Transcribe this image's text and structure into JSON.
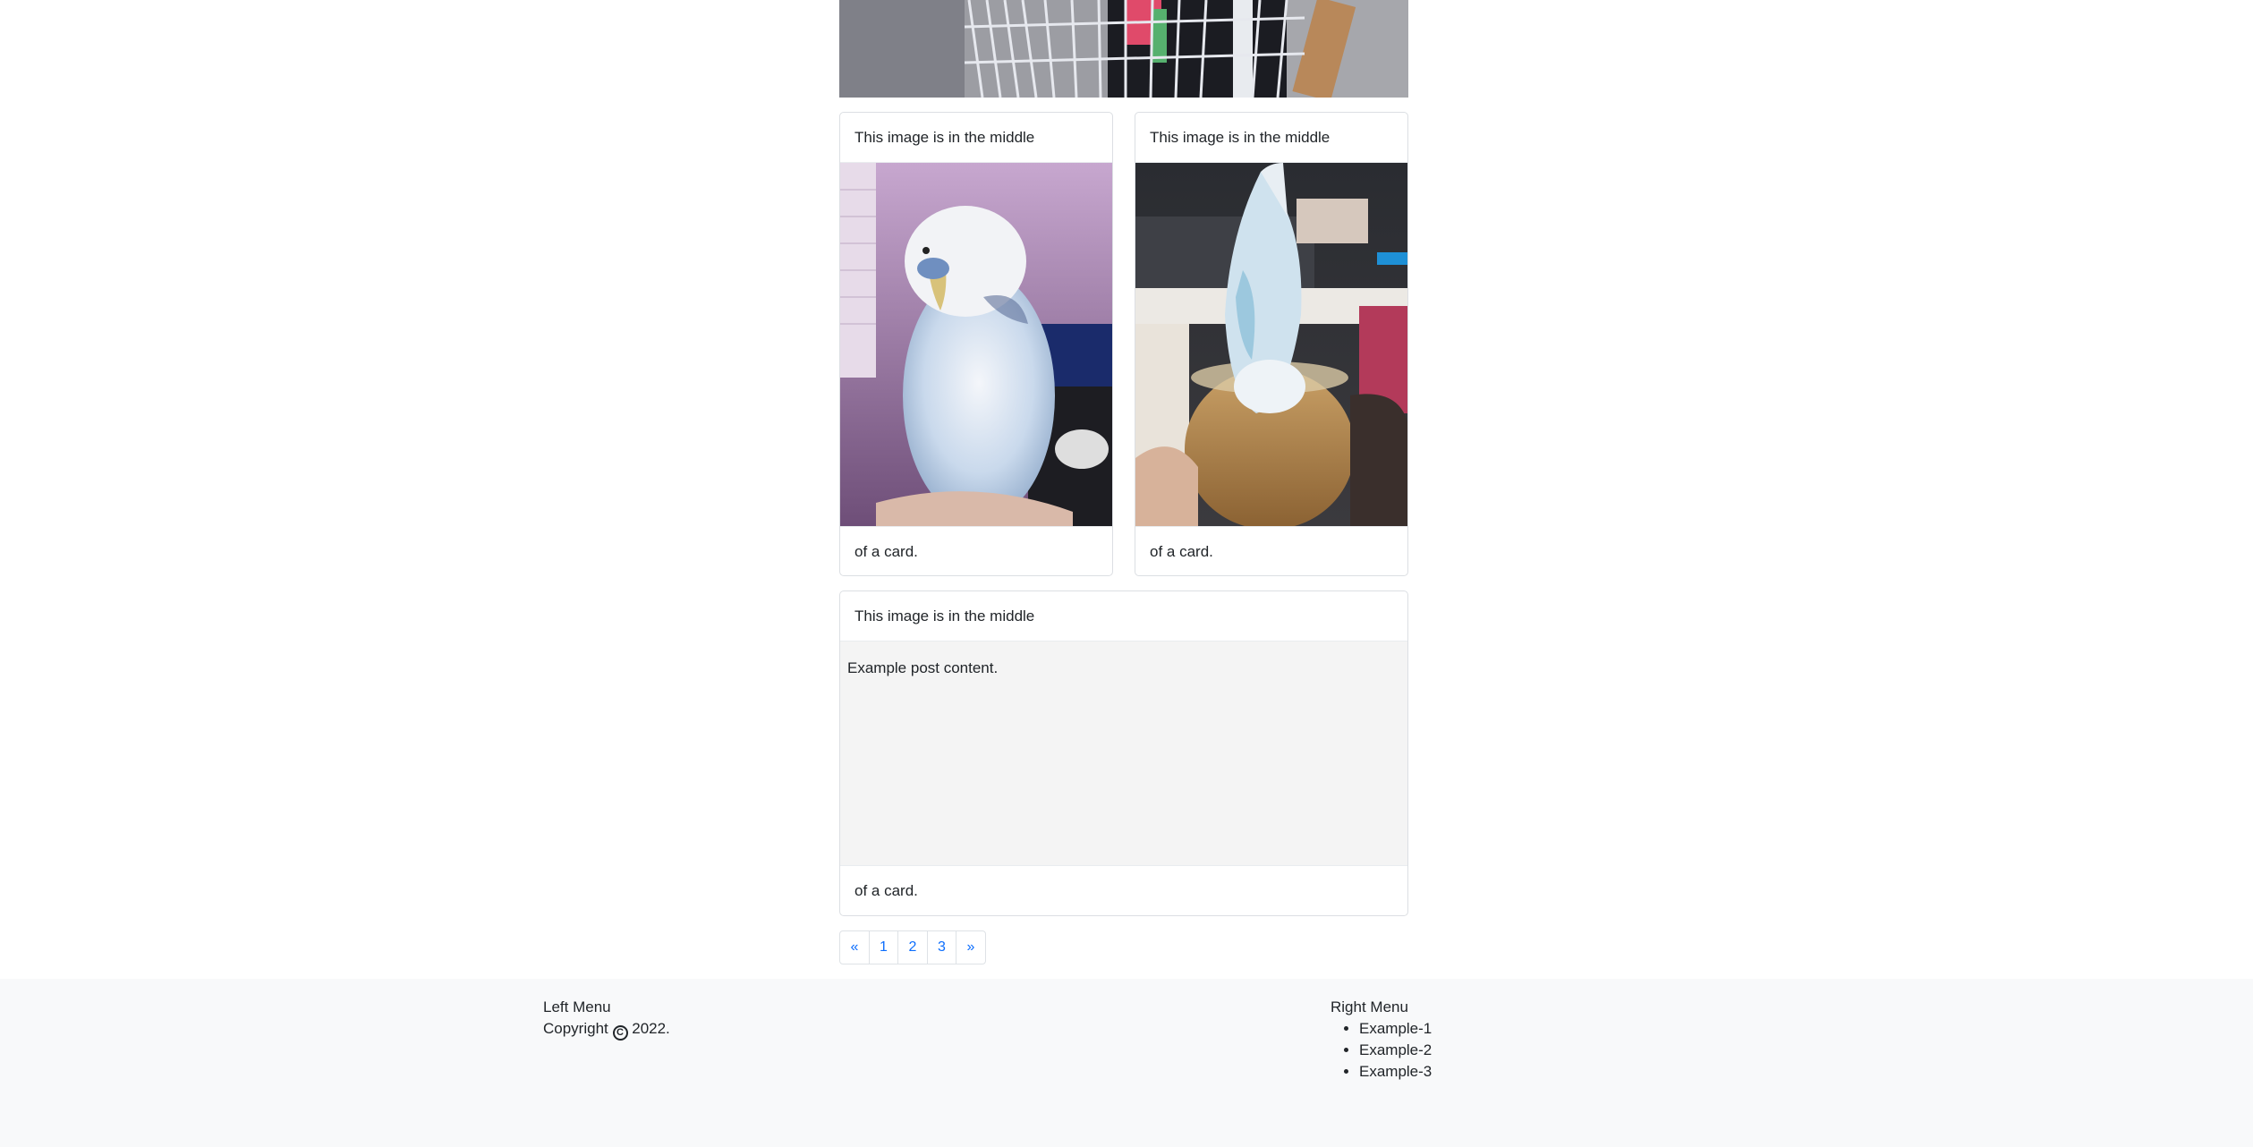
{
  "cards": {
    "card1": {
      "header": "This image is in the middle",
      "footer": "of a card."
    },
    "card2": {
      "header": "This image is in the middle",
      "footer": "of a card."
    },
    "card3": {
      "header": "This image is in the middle",
      "body": "Example post content.",
      "footer": "of a card."
    }
  },
  "pagination": {
    "prev": "«",
    "pages": [
      "1",
      "2",
      "3"
    ],
    "next": "»"
  },
  "footer": {
    "left_title": "Left Menu",
    "copyright_prefix": "Copyright",
    "copyright_symbol": "C",
    "copyright_year": "2022.",
    "right_title": "Right Menu",
    "right_items": [
      "Example-1",
      "Example-2",
      "Example-3"
    ]
  },
  "colors": {
    "link": "#0d6efd",
    "footer_bg": "#f8f9fa",
    "card_border": "#dcdfe3",
    "grey_body": "#f4f4f4"
  }
}
